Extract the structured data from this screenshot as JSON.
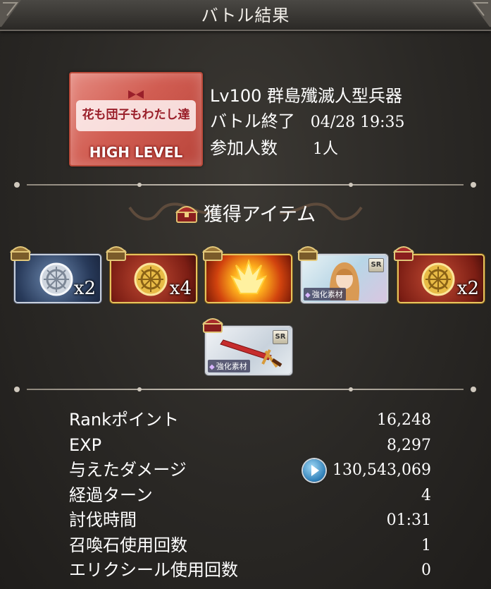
{
  "header": {
    "title": "バトル結果"
  },
  "battle": {
    "thumbnail_logo": "花も団子もわたし達",
    "thumbnail_level": "HIGH LEVEL",
    "quest_name": "Lv100 群島殲滅人型兵器",
    "end_label": "バトル終了",
    "end_datetime": "04/28 19:35",
    "participants_label": "参加人数",
    "participants_value": "1人"
  },
  "items_section": {
    "title": "獲得アイテム",
    "items": [
      {
        "kind": "silver-medal",
        "quantity": "x2"
      },
      {
        "kind": "gold-medal",
        "quantity": "x4"
      },
      {
        "kind": "fire-crystal",
        "quantity": ""
      },
      {
        "kind": "character-sr",
        "badge": "SR",
        "tag": "強化素材"
      },
      {
        "kind": "gold-medal",
        "quantity": "x2"
      },
      {
        "kind": "weapon-sr",
        "badge": "SR",
        "tag": "強化素材"
      }
    ]
  },
  "stats": [
    {
      "label": "Rankポイント",
      "value": "16,248"
    },
    {
      "label": "EXP",
      "value": "8,297"
    },
    {
      "label": "与えたダメージ",
      "value": "130,543,069"
    },
    {
      "label": "経過ターン",
      "value": "4"
    },
    {
      "label": "討伐時間",
      "value": "01:31"
    },
    {
      "label": "召喚石使用回数",
      "value": "1"
    },
    {
      "label": "エリクシール使用回数",
      "value": "0"
    }
  ],
  "colors": {
    "background": "#2a2825",
    "thumb_red": "#d15d52",
    "gold_frame": "#e6c45d",
    "play_blue": "#2f7fb8"
  }
}
